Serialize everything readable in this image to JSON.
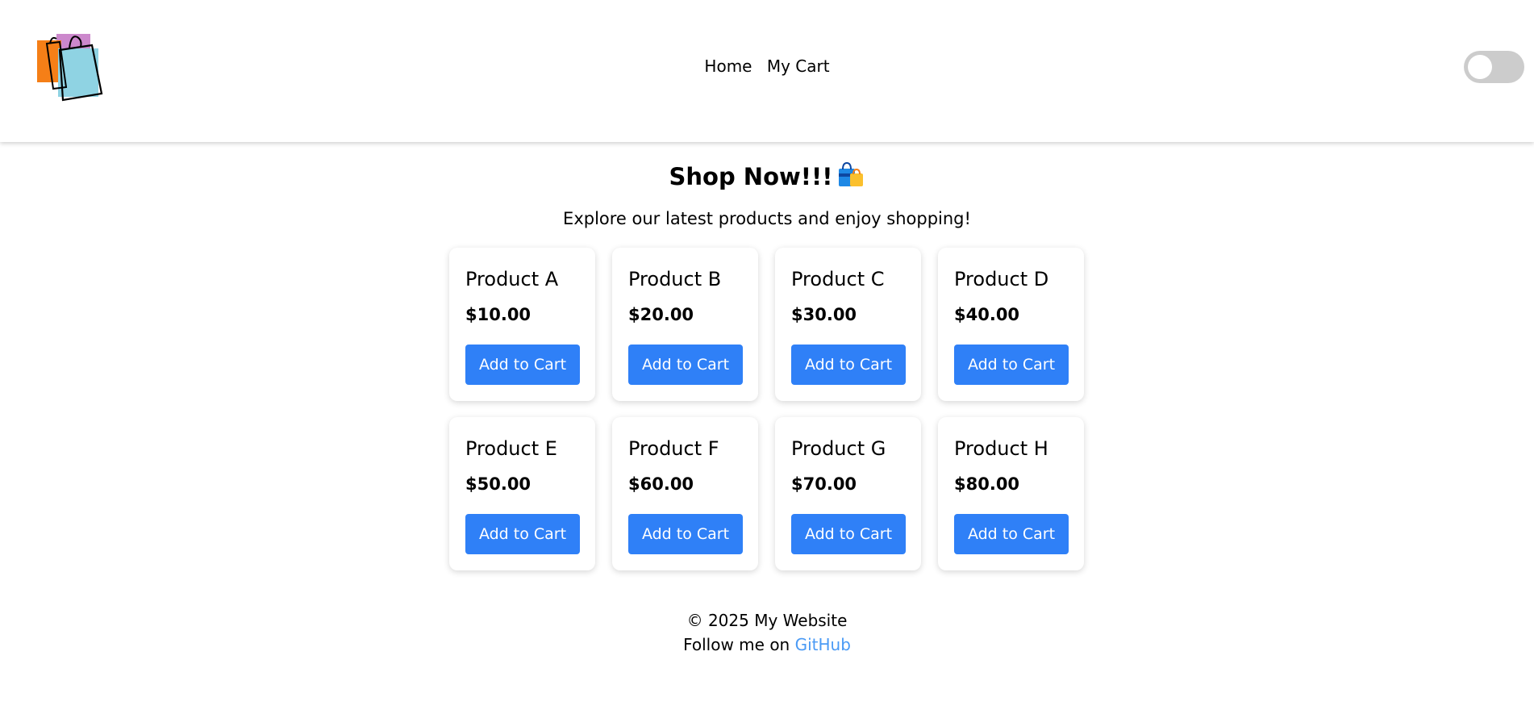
{
  "nav": {
    "logo": "shopping-bags-logo",
    "links": [
      "Home",
      "My Cart"
    ],
    "theme_toggle": "dark-mode-toggle",
    "theme_toggle_on": false
  },
  "hero": {
    "title": "Shop Now!!!",
    "title_icon": "shopping-bags-emoji",
    "subtitle": "Explore our latest products and enjoy shopping!"
  },
  "products": [
    {
      "name": "Product A",
      "price": "$10.00",
      "button": "Add to Cart"
    },
    {
      "name": "Product B",
      "price": "$20.00",
      "button": "Add to Cart"
    },
    {
      "name": "Product C",
      "price": "$30.00",
      "button": "Add to Cart"
    },
    {
      "name": "Product D",
      "price": "$40.00",
      "button": "Add to Cart"
    },
    {
      "name": "Product E",
      "price": "$50.00",
      "button": "Add to Cart"
    },
    {
      "name": "Product F",
      "price": "$60.00",
      "button": "Add to Cart"
    },
    {
      "name": "Product G",
      "price": "$70.00",
      "button": "Add to Cart"
    },
    {
      "name": "Product H",
      "price": "$80.00",
      "button": "Add to Cart"
    }
  ],
  "footer": {
    "copyright": "© 2025 My Website",
    "follow_text": "Follow me on",
    "link_label": "GitHub"
  },
  "colors": {
    "accent": "#2f80f7",
    "link": "#4a9af5",
    "toggle_track": "#cccccc"
  }
}
